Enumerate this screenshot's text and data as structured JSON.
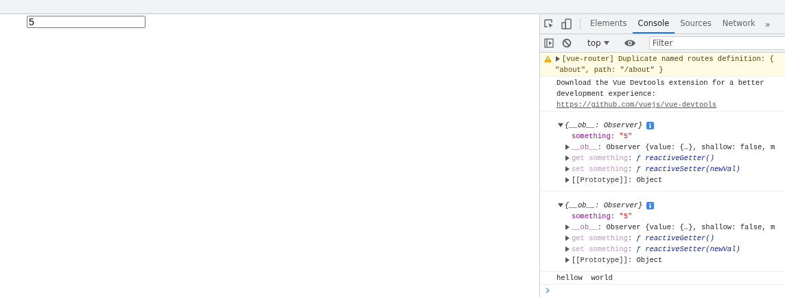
{
  "page": {
    "input_value": "5"
  },
  "devtools": {
    "tabs": [
      {
        "label": "Elements",
        "selected": false
      },
      {
        "label": "Console",
        "selected": true
      },
      {
        "label": "Sources",
        "selected": false
      },
      {
        "label": "Network",
        "selected": false
      }
    ],
    "more_tabs": "»",
    "context": "top",
    "filter": {
      "placeholder": "Filter"
    },
    "separator": ":",
    "messages": [
      {
        "kind": "warning",
        "expandable": true,
        "lines": [
          "[vue-router] Duplicate named routes definition: {",
          "\"about\", path: \"/about\" }"
        ]
      },
      {
        "kind": "info",
        "lines": [
          "Download the Vue Devtools extension for a better",
          "development experience:"
        ],
        "link": "https://github.com/vuejs/vue-devtools"
      },
      {
        "kind": "object",
        "header": "{__ob__: Observer}",
        "expanded": true,
        "properties": [
          {
            "kind": "own",
            "key": "something",
            "value": "\"5\"",
            "expandable": false
          },
          {
            "kind": "internal",
            "key": "__ob__",
            "value": "Observer {value: {…}, shallow: false, m",
            "expandable": true
          },
          {
            "kind": "accessor",
            "key": "get something",
            "value": "ƒ reactiveGetter()",
            "expandable": true
          },
          {
            "kind": "accessor",
            "key": "set something",
            "value": "ƒ reactiveSetter(newVal)",
            "expandable": true
          },
          {
            "kind": "proto",
            "key": "[[Prototype]]",
            "value": "Object",
            "expandable": true
          }
        ]
      },
      {
        "kind": "object",
        "header": "{__ob__: Observer}",
        "expanded": true,
        "properties": [
          {
            "kind": "own",
            "key": "something",
            "value": "\"5\"",
            "expandable": false
          },
          {
            "kind": "internal",
            "key": "__ob__",
            "value": "Observer {value: {…}, shallow: false, m",
            "expandable": true
          },
          {
            "kind": "accessor",
            "key": "get something",
            "value": "ƒ reactiveGetter()",
            "expandable": true
          },
          {
            "kind": "accessor",
            "key": "set something",
            "value": "ƒ reactiveSetter(newVal)",
            "expandable": true
          },
          {
            "kind": "proto",
            "key": "[[Prototype]]",
            "value": "Object",
            "expandable": true
          }
        ]
      },
      {
        "kind": "log",
        "lines": [
          "hellow  world"
        ]
      }
    ]
  }
}
